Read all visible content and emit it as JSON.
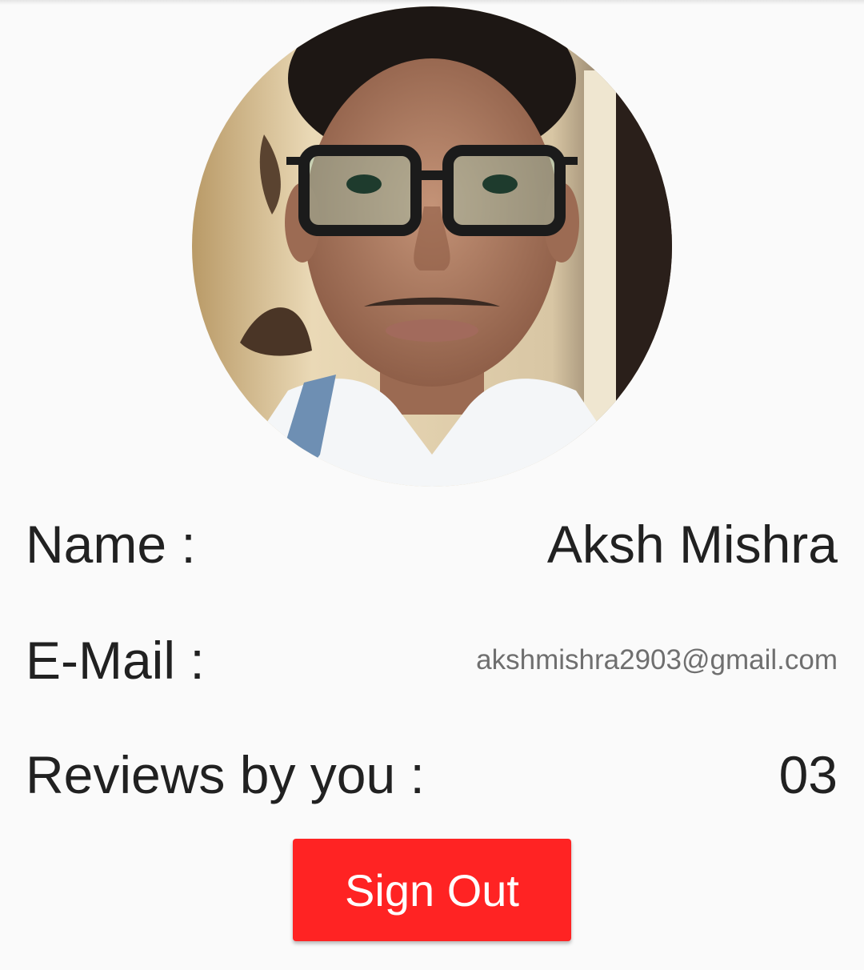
{
  "profile": {
    "avatar_icon": "user-photo",
    "name_label": "Name :",
    "name_value": "Aksh Mishra",
    "email_label": "E-Mail :",
    "email_value": "akshmishra2903@gmail.com",
    "reviews_label": "Reviews by you :",
    "reviews_value": "03"
  },
  "actions": {
    "signout_label": "Sign Out"
  },
  "colors": {
    "background": "#fafafa",
    "text_primary": "#212121",
    "text_secondary": "#6f6f6f",
    "signout_button": "#ff2323"
  }
}
